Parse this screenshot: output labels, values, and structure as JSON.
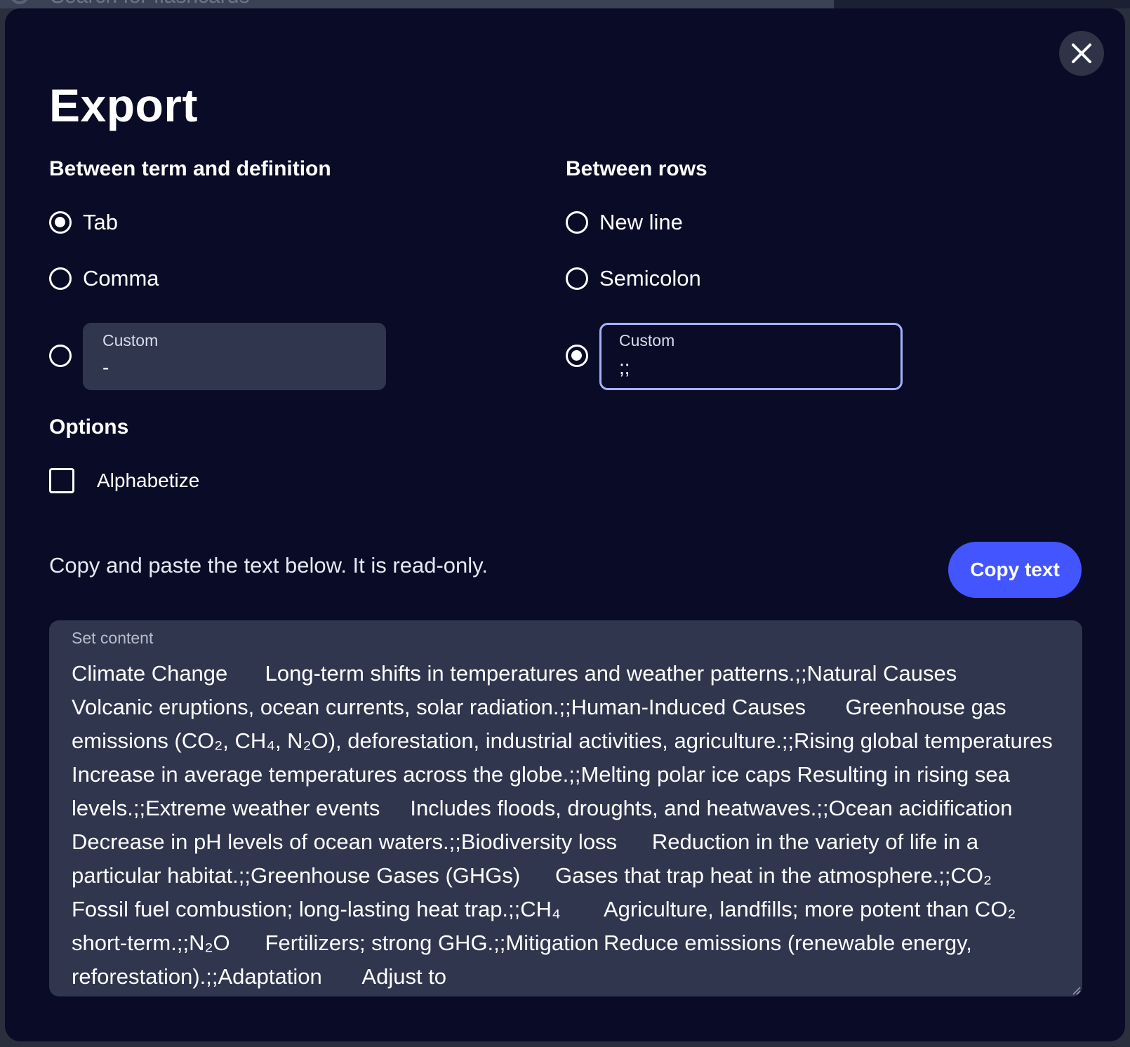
{
  "background": {
    "search_placeholder": "Search for flashcards"
  },
  "modal": {
    "title": "Export",
    "close_icon": "close-icon"
  },
  "term_definition": {
    "label": "Between term and definition",
    "options": [
      {
        "label": "Tab",
        "checked": true
      },
      {
        "label": "Comma",
        "checked": false
      }
    ],
    "custom": {
      "label": "Custom",
      "value": "-",
      "checked": false
    }
  },
  "rows": {
    "label": "Between rows",
    "options": [
      {
        "label": "New line",
        "checked": false
      },
      {
        "label": "Semicolon",
        "checked": false
      }
    ],
    "custom": {
      "label": "Custom",
      "value": ";;",
      "checked": true
    }
  },
  "options": {
    "label": "Options",
    "alphabetize": {
      "label": "Alphabetize",
      "checked": false
    }
  },
  "copy": {
    "hint": "Copy and paste the text below. It is read-only.",
    "button_label": "Copy text"
  },
  "set_content": {
    "label": "Set content",
    "text": "Climate Change\tLong-term shifts in temperatures and weather patterns.;;Natural Causes\tVolcanic eruptions, ocean currents, solar radiation.;;Human-Induced Causes\tGreenhouse gas emissions (CO₂, CH₄, N₂O), deforestation, industrial activities, agriculture.;;Rising global temperatures\tIncrease in average temperatures across the globe.;;Melting polar ice caps\tResulting in rising sea levels.;;Extreme weather events\tIncludes floods, droughts, and heatwaves.;;Ocean acidification\tDecrease in pH levels of ocean waters.;;Biodiversity loss\tReduction in the variety of life in a particular habitat.;;Greenhouse Gases (GHGs)\tGases that trap heat in the atmosphere.;;CO₂\tFossil fuel combustion; long-lasting heat trap.;;CH₄\tAgriculture, landfills; more potent than CO₂ short-term.;;N₂O\tFertilizers; strong GHG.;;Mitigation\tReduce emissions (renewable energy, reforestation).;;Adaptation\tAdjust to"
  },
  "colors": {
    "modal_bg": "#0a0b26",
    "field_bg": "#30364d",
    "accent": "#4255ff",
    "focus_border": "#a8b1ff"
  }
}
